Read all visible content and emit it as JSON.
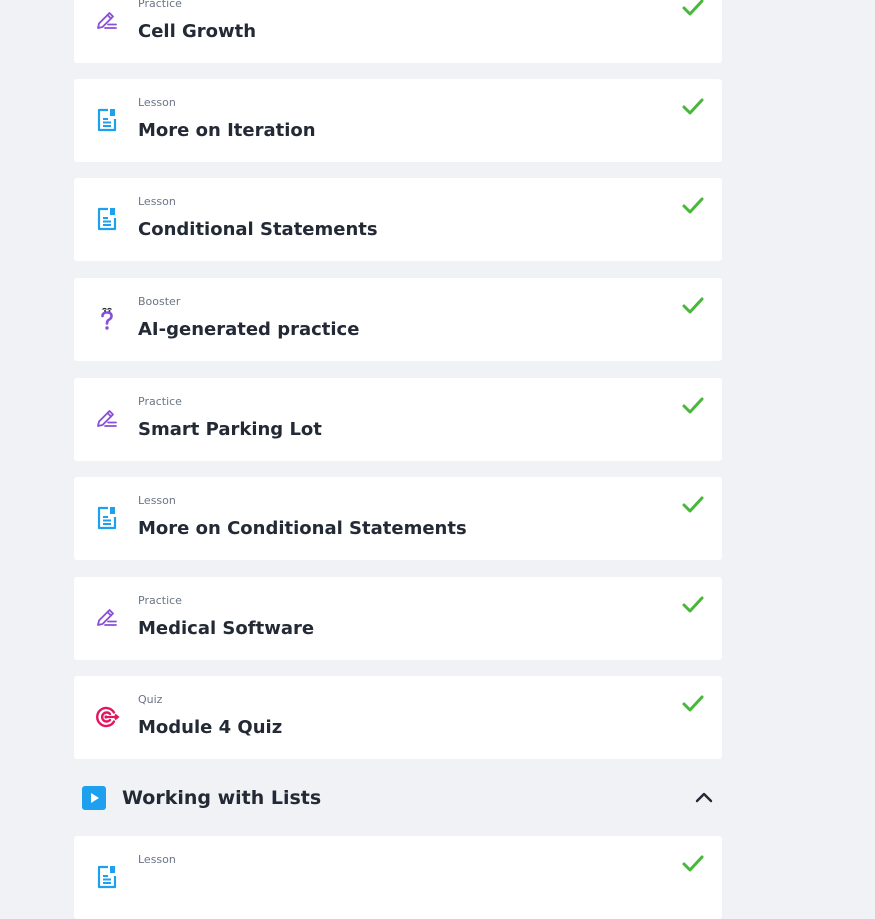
{
  "colors": {
    "background": "#f0f2f5",
    "card": "#ffffff",
    "practice_icon": "#8a4fd8",
    "lesson_icon": "#1ea0ef",
    "booster_icon": "#8a4fd8",
    "quiz_icon": "#e3175f",
    "check": "#46b83a",
    "title_text": "#232a35",
    "kind_text": "#6b7686"
  },
  "items": [
    {
      "kind": "Practice",
      "title": "Cell Growth",
      "icon": "pencil-icon",
      "completed": true
    },
    {
      "kind": "Lesson",
      "title": "More on Iteration",
      "icon": "document-icon",
      "completed": true
    },
    {
      "kind": "Lesson",
      "title": "Conditional Statements",
      "icon": "document-icon",
      "completed": true
    },
    {
      "kind": "Booster",
      "title": "AI-generated practice",
      "icon": "question-mark-icon",
      "completed": true
    },
    {
      "kind": "Practice",
      "title": "Smart Parking Lot",
      "icon": "pencil-icon",
      "completed": true
    },
    {
      "kind": "Lesson",
      "title": "More on Conditional Statements",
      "icon": "document-icon",
      "completed": true
    },
    {
      "kind": "Practice",
      "title": "Medical Software",
      "icon": "pencil-icon",
      "completed": true
    },
    {
      "kind": "Quiz",
      "title": "Module 4 Quiz",
      "icon": "target-icon",
      "completed": true
    }
  ],
  "section": {
    "title": "Working with Lists",
    "icon": "play-icon",
    "expanded": true
  },
  "next_items": [
    {
      "kind": "Lesson",
      "title": "",
      "icon": "document-icon",
      "completed": true
    }
  ]
}
